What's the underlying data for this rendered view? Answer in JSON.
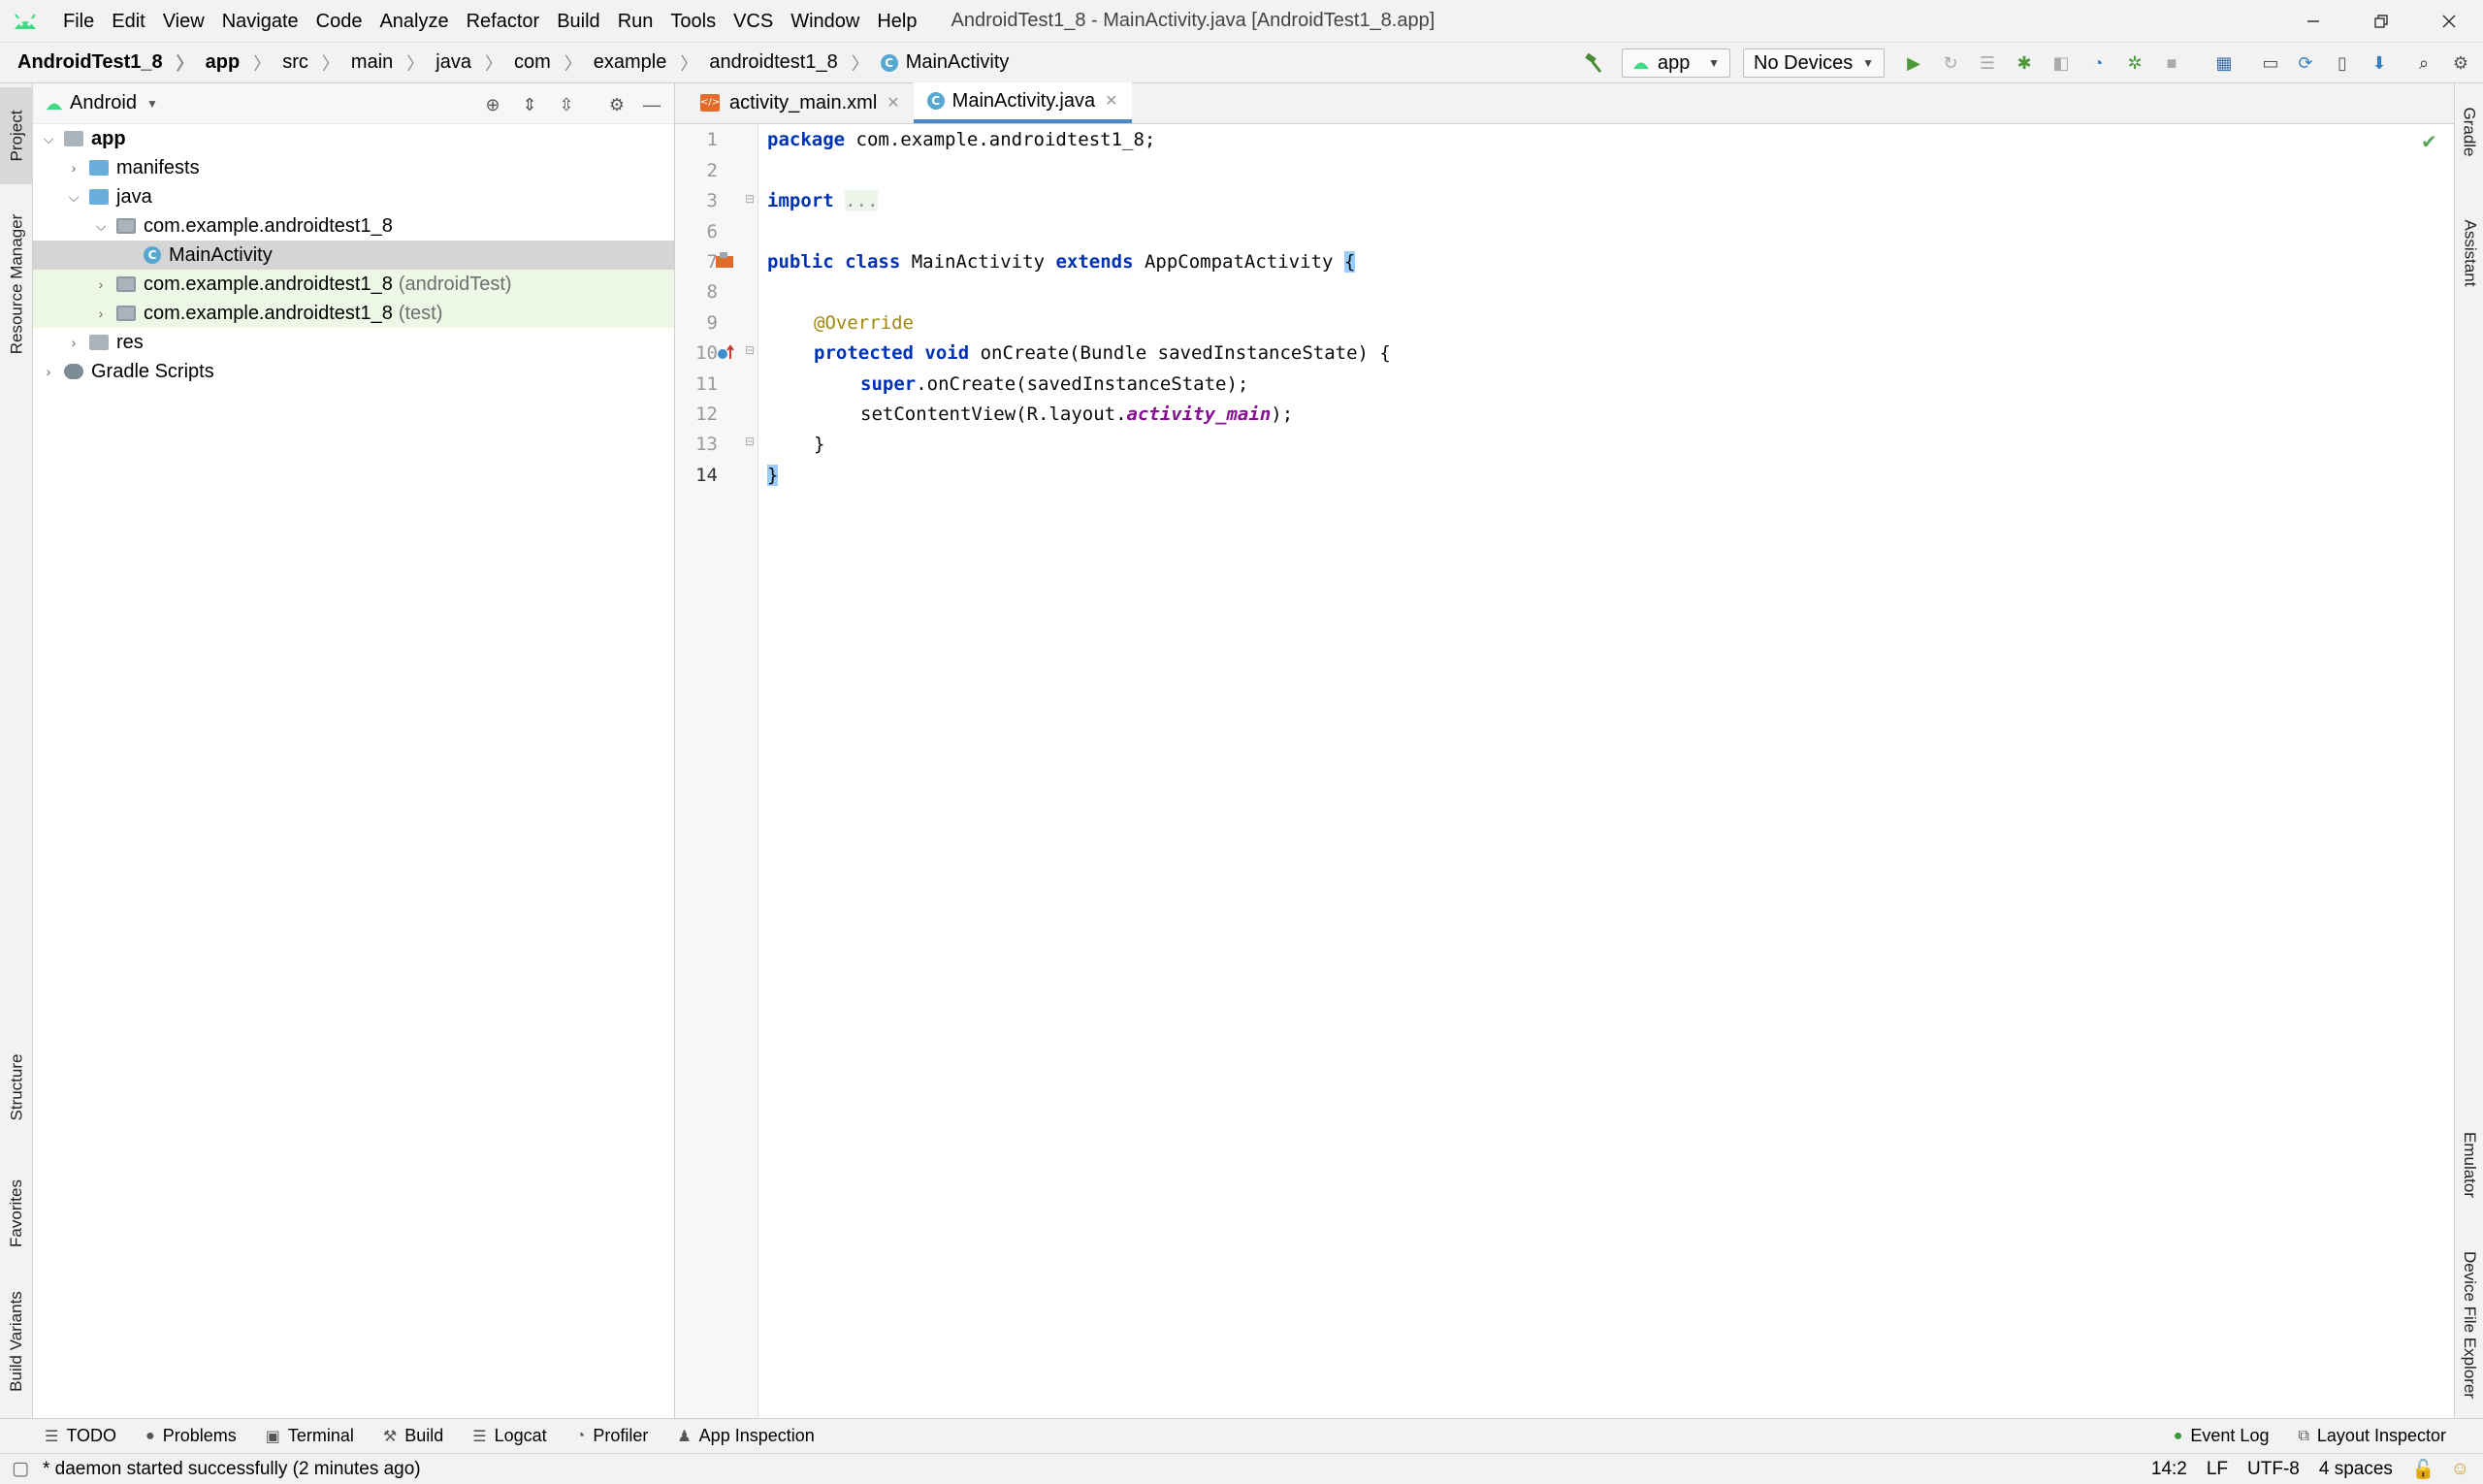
{
  "menu": {
    "items": [
      "File",
      "Edit",
      "View",
      "Navigate",
      "Code",
      "Analyze",
      "Refactor",
      "Build",
      "Run",
      "Tools",
      "VCS",
      "Window",
      "Help"
    ],
    "window_title": "AndroidTest1_8 - MainActivity.java [AndroidTest1_8.app]"
  },
  "breadcrumbs": [
    "AndroidTest1_8",
    "app",
    "src",
    "main",
    "java",
    "com",
    "example",
    "androidtest1_8",
    "MainActivity"
  ],
  "toolbar": {
    "run_config": "app",
    "device": "No Devices"
  },
  "left_stripe": {
    "project": "Project",
    "resource_manager": "Resource Manager",
    "structure": "Structure",
    "favorites": "Favorites",
    "build_variants": "Build Variants"
  },
  "right_stripe": {
    "gradle": "Gradle",
    "assistant": "Assistant",
    "emulator": "Emulator",
    "device_file_explorer": "Device File Explorer"
  },
  "project_panel": {
    "view_mode": "Android",
    "tree": [
      {
        "label": "app",
        "suffix": ""
      },
      {
        "label": "manifests",
        "suffix": ""
      },
      {
        "label": "java",
        "suffix": ""
      },
      {
        "label": "com.example.androidtest1_8",
        "suffix": ""
      },
      {
        "label": "MainActivity",
        "suffix": ""
      },
      {
        "label": "com.example.androidtest1_8",
        "suffix": "(androidTest)"
      },
      {
        "label": "com.example.androidtest1_8",
        "suffix": "(test)"
      },
      {
        "label": "res",
        "suffix": ""
      },
      {
        "label": "Gradle Scripts",
        "suffix": ""
      }
    ]
  },
  "editor": {
    "tabs": [
      "activity_main.xml",
      "MainActivity.java"
    ],
    "active_tab": "MainActivity.java",
    "line_numbers": [
      "1",
      "2",
      "3",
      "6",
      "7",
      "8",
      "9",
      "10",
      "11",
      "12",
      "13",
      "14"
    ],
    "code": {
      "l1_kw": "package",
      "l1_rest": " com.example.androidtest1_8;",
      "l3_kw": "import",
      "l3_fold": "...",
      "l7_kw1": "public",
      "l7_kw2": "class",
      "l7_name": " MainActivity ",
      "l7_kw3": "extends",
      "l7_rest": " AppCompatActivity ",
      "l7_brace": "{",
      "l9_ann": "@Override",
      "l10_kw1": "protected",
      "l10_kw2": "void",
      "l10_rest": " onCreate(Bundle savedInstanceState) {",
      "l11_kw": "super",
      "l11_rest": ".onCreate(savedInstanceState);",
      "l12_pre": "setContentView(R.layout.",
      "l12_ital": "activity_main",
      "l12_post": ");",
      "l13": "}",
      "l14": "}"
    }
  },
  "bottom_tools": {
    "left": [
      "TODO",
      "Problems",
      "Terminal",
      "Build",
      "Logcat",
      "Profiler",
      "App Inspection"
    ],
    "right": [
      "Event Log",
      "Layout Inspector"
    ]
  },
  "status": {
    "message": "* daemon started successfully (2 minutes ago)",
    "position": "14:2",
    "line_sep": "LF",
    "encoding": "UTF-8",
    "indent": "4 spaces"
  }
}
